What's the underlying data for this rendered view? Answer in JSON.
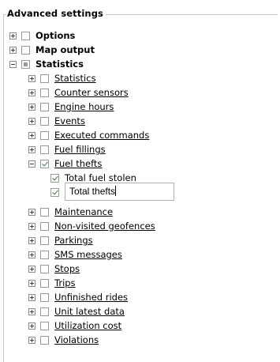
{
  "panel": {
    "title": "Advanced settings"
  },
  "tree": {
    "options": "Options",
    "map_output": "Map output",
    "statistics_group": "Statistics",
    "statistics": "Statistics",
    "counter_sensors": "Counter sensors",
    "engine_hours": "Engine hours",
    "events": "Events",
    "executed_commands": "Executed commands",
    "fuel_fillings": "Fuel fillings",
    "fuel_thefts": "Fuel thefts",
    "total_fuel_stolen": "Total fuel stolen",
    "total_thefts_value": "Total thefts",
    "maintenance": "Maintenance",
    "non_visited_geofences": "Non-visited geofences",
    "parkings": "Parkings",
    "sms_messages": "SMS messages",
    "stops": "Stops",
    "trips": "Trips",
    "unfinished_rides": "Unfinished rides",
    "unit_latest_data": "Unit latest data",
    "utilization_cost": "Utilization cost",
    "violations": "Violations"
  }
}
